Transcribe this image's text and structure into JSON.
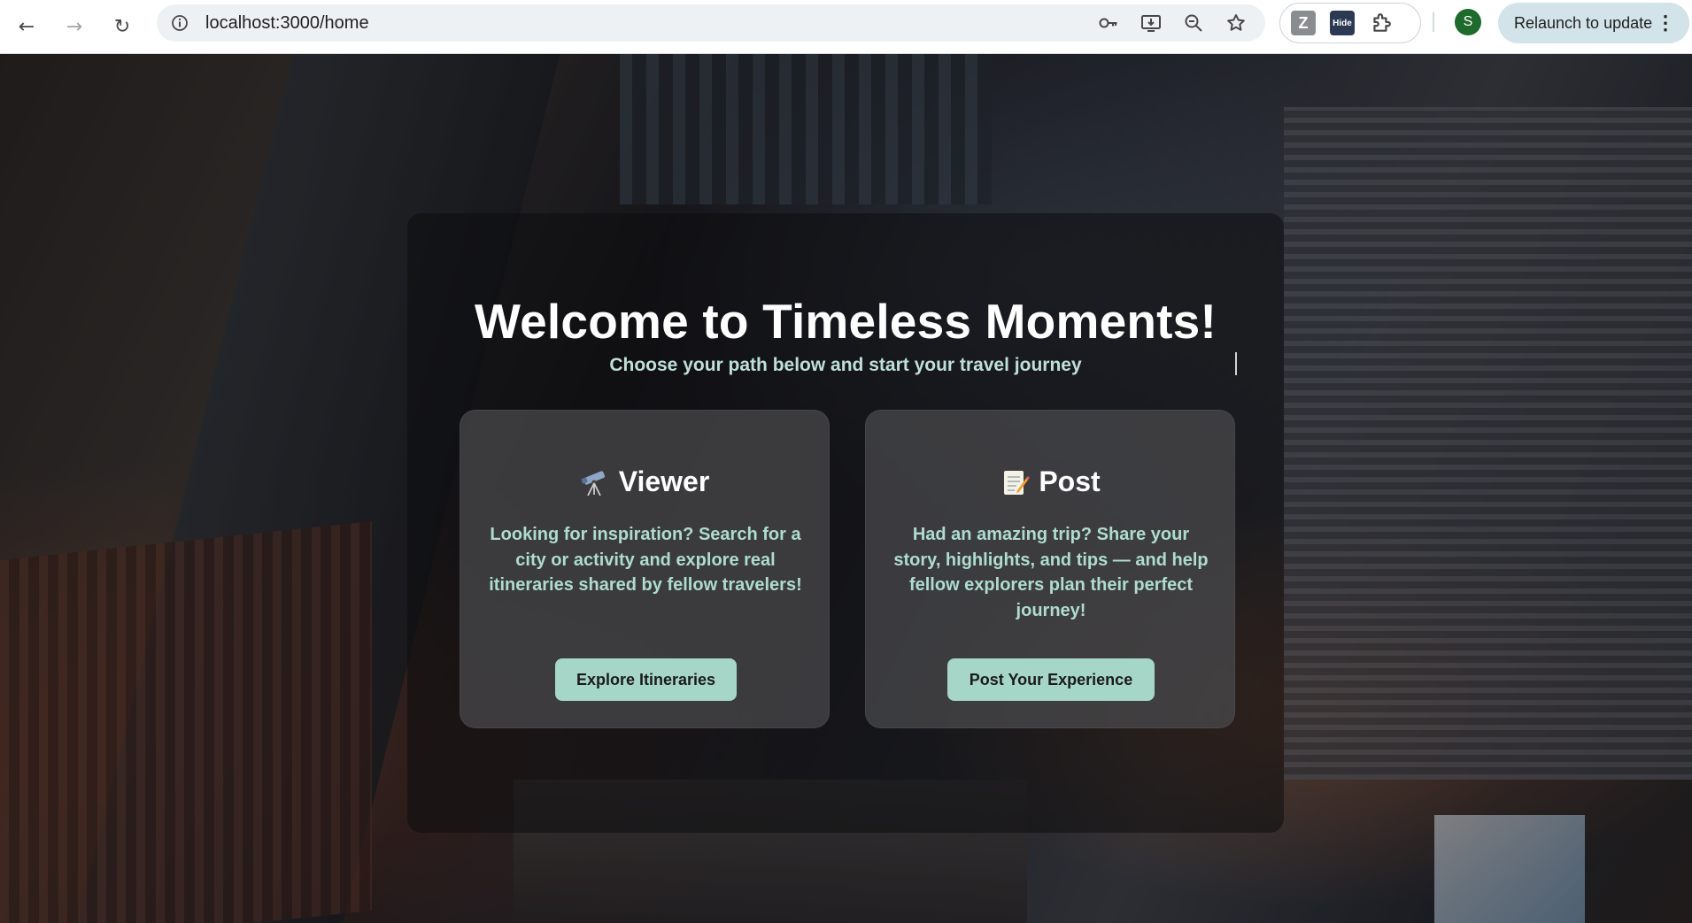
{
  "browser": {
    "url": "localhost:3000/home",
    "profile_initial": "S",
    "relaunch_label": "Relaunch to update",
    "extensions": [
      {
        "name": "notes-extension",
        "glyph": "Z"
      },
      {
        "name": "hide-extension",
        "glyph": "Hide"
      }
    ],
    "icons": [
      "back-icon",
      "forward-icon",
      "reload-icon",
      "site-info-icon",
      "password-key-icon",
      "install-app-icon",
      "zoom-icon",
      "bookmark-star-icon",
      "extensions-puzzle-icon",
      "more-menu-icon"
    ]
  },
  "hero": {
    "title": "Welcome to Timeless Moments!",
    "subtitle": "Choose your path below and start your travel journey"
  },
  "cards": {
    "viewer": {
      "icon": "telescope-icon",
      "title": "Viewer",
      "description": "Looking for inspiration? Search for a city or activity and explore real itineraries shared by fellow travelers!",
      "button": "Explore Itineraries"
    },
    "post": {
      "icon": "memo-icon",
      "title": "Post",
      "description": "Had an amazing trip? Share your story, highlights, and tips — and help fellow explorers plan their perfect journey!",
      "button": "Post Your Experience"
    }
  },
  "colors": {
    "accent_button": "#a6d6c8",
    "card_text": "#aedccd",
    "subtitle_text": "#bfe0d6",
    "profile_avatar": "#1e6b2d",
    "relaunch_pill": "#d3e3ea"
  }
}
